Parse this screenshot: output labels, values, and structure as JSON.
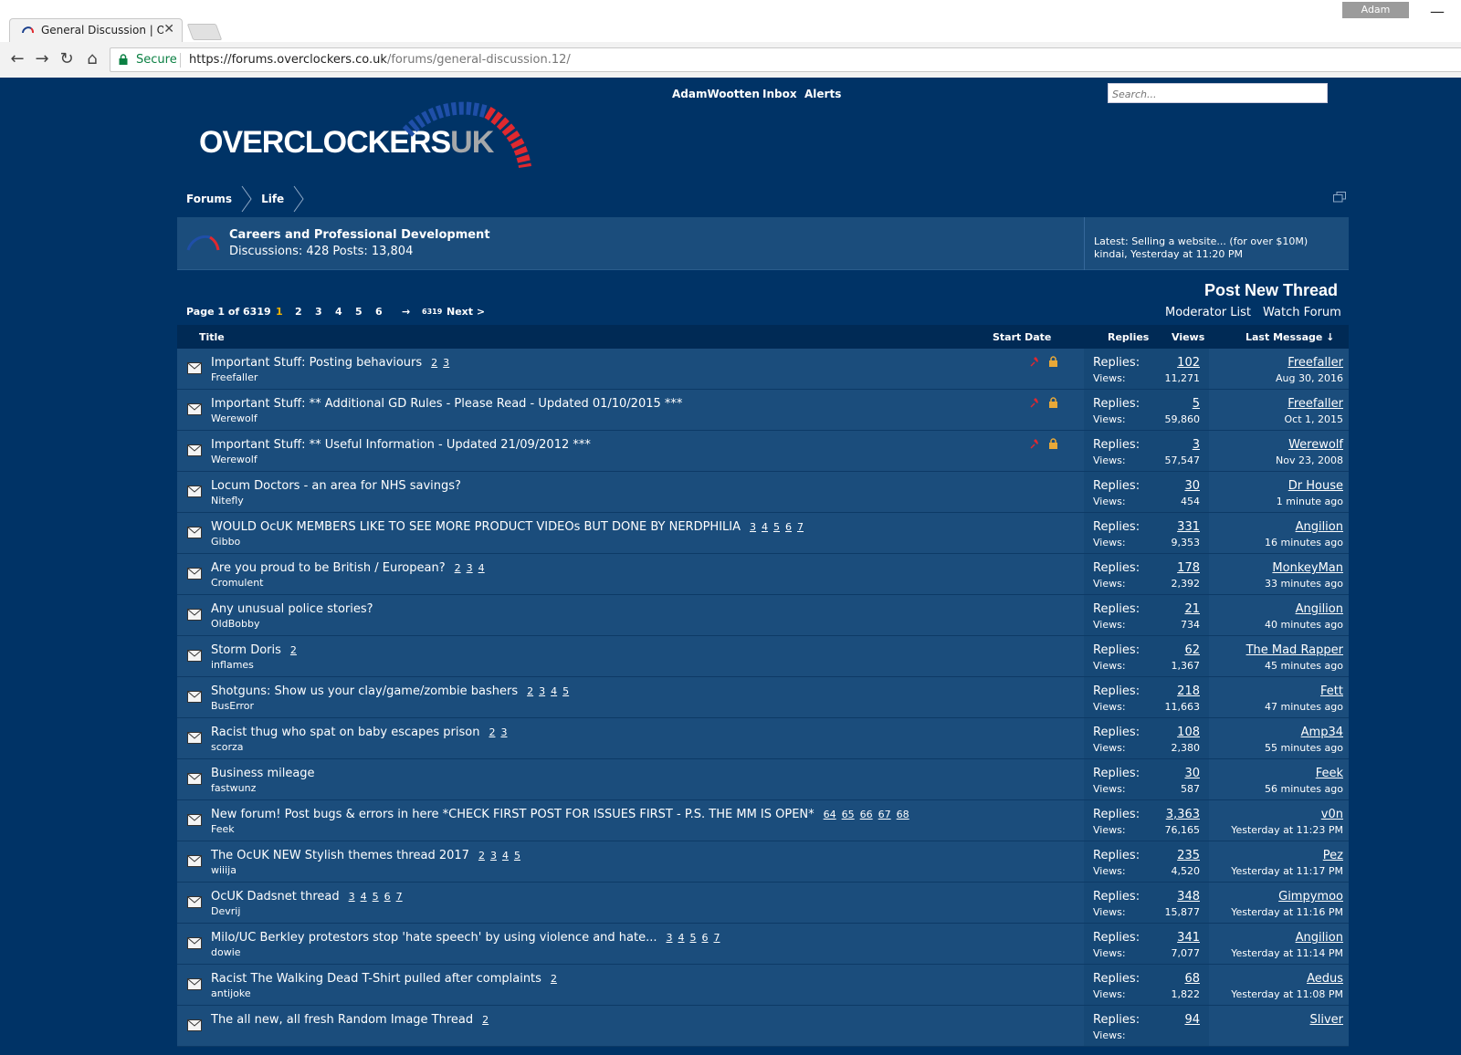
{
  "browser": {
    "tab_title": "General Discussion | Ove",
    "profile_name": "Adam",
    "secure_label": "Secure",
    "url_prefix": "https://forums.overclockers.co.uk",
    "url_path": "/forums/general-discussion.12/"
  },
  "header": {
    "nav": {
      "user": "AdamWootten",
      "inbox": "Inbox",
      "alerts": "Alerts"
    },
    "search_placeholder": "Search...",
    "logo_main": "OVERCLOCKERS",
    "logo_uk": "UK"
  },
  "breadcrumb": [
    "Forums",
    "Life"
  ],
  "forum_box": {
    "name": "Careers and Professional Development",
    "stats": "Discussions: 428 Posts: 13,804",
    "latest_line1": "Latest: Selling a website... (for over $10M)",
    "latest_line2": "kindai, Yesterday at 11:20 PM"
  },
  "actions": {
    "post_new_thread": "Post New Thread",
    "moderator_list": "Moderator List",
    "watch_forum": "Watch Forum"
  },
  "pagination": {
    "page_of": "Page 1 of 6319",
    "current": "1",
    "pages": [
      "2",
      "3",
      "4",
      "5",
      "6"
    ],
    "arrow": "→",
    "last": "6319",
    "next": "Next >"
  },
  "columns": {
    "title": "Title",
    "start_date": "Start Date",
    "replies": "Replies",
    "views": "Views",
    "last_message": "Last Message ↓"
  },
  "stat_labels": {
    "replies": "Replies:",
    "views": "Views:"
  },
  "threads": [
    {
      "prefix": "Important Stuff:",
      "title": "Posting behaviours",
      "pages": "2 3",
      "author": "Freefaller",
      "replies": "102",
      "views": "11,271",
      "last_user": "Freefaller",
      "last_time": "Aug 30, 2016",
      "sticky": true
    },
    {
      "prefix": "Important Stuff:",
      "title": "** Additional GD Rules - Please Read - Updated 01/10/2015 ***",
      "pages": "",
      "author": "Werewolf",
      "replies": "5",
      "views": "59,860",
      "last_user": "Freefaller",
      "last_time": "Oct 1, 2015",
      "sticky": true
    },
    {
      "prefix": "Important Stuff:",
      "title": "** Useful Information - Updated 21/09/2012 ***",
      "pages": "",
      "author": "Werewolf",
      "replies": "3",
      "views": "57,547",
      "last_user": "Werewolf",
      "last_time": "Nov 23, 2008",
      "sticky": true
    },
    {
      "prefix": "",
      "title": "Locum Doctors - an area for NHS savings?",
      "pages": "",
      "author": "Nitefly",
      "replies": "30",
      "views": "454",
      "last_user": "Dr House",
      "last_time": "1 minute ago",
      "sticky": false
    },
    {
      "prefix": "",
      "title": "WOULD OcUK MEMBERS LIKE TO SEE MORE PRODUCT VIDEOs BUT DONE BY NERDPHILIA",
      "pages": "3 4 5 6 7",
      "author": "Gibbo",
      "replies": "331",
      "views": "9,353",
      "last_user": "Angilion",
      "last_time": "16 minutes ago",
      "sticky": false
    },
    {
      "prefix": "",
      "title": "Are you proud to be British / European?",
      "pages": "2 3 4",
      "author": "Cromulent",
      "replies": "178",
      "views": "2,392",
      "last_user": "MonkeyMan",
      "last_time": "33 minutes ago",
      "sticky": false
    },
    {
      "prefix": "",
      "title": "Any unusual police stories?",
      "pages": "",
      "author": "OldBobby",
      "replies": "21",
      "views": "734",
      "last_user": "Angilion",
      "last_time": "40 minutes ago",
      "sticky": false
    },
    {
      "prefix": "",
      "title": "Storm Doris",
      "pages": "2",
      "author": "inflames",
      "replies": "62",
      "views": "1,367",
      "last_user": "The Mad Rapper",
      "last_time": "45 minutes ago",
      "sticky": false
    },
    {
      "prefix": "",
      "title": "Shotguns: Show us your clay/game/zombie bashers",
      "pages": "2 3 4 5",
      "author": "BusError",
      "replies": "218",
      "views": "11,663",
      "last_user": "Fett",
      "last_time": "47 minutes ago",
      "sticky": false
    },
    {
      "prefix": "",
      "title": "Racist thug who spat on baby escapes prison",
      "pages": "2 3",
      "author": "scorza",
      "replies": "108",
      "views": "2,380",
      "last_user": "Amp34",
      "last_time": "55 minutes ago",
      "sticky": false
    },
    {
      "prefix": "",
      "title": "Business mileage",
      "pages": "",
      "author": "fastwunz",
      "replies": "30",
      "views": "587",
      "last_user": "Feek",
      "last_time": "56 minutes ago",
      "sticky": false
    },
    {
      "prefix": "",
      "title": "New forum! Post bugs & errors in here *CHECK FIRST POST FOR ISSUES FIRST - P.S. THE MM IS OPEN*",
      "pages": "64 65 66 67 68",
      "author": "Feek",
      "replies": "3,363",
      "views": "76,165",
      "last_user": "v0n",
      "last_time": "Yesterday at 11:23 PM",
      "sticky": false
    },
    {
      "prefix": "",
      "title": "The OcUK NEW Stylish themes thread 2017",
      "pages": "2 3 4 5",
      "author": "wiiija",
      "replies": "235",
      "views": "4,520",
      "last_user": "Pez",
      "last_time": "Yesterday at 11:17 PM",
      "sticky": false
    },
    {
      "prefix": "",
      "title": "OcUK Dadsnet thread",
      "pages": "3 4 5 6 7",
      "author": "Devrij",
      "replies": "348",
      "views": "15,877",
      "last_user": "Gimpymoo",
      "last_time": "Yesterday at 11:16 PM",
      "sticky": false
    },
    {
      "prefix": "",
      "title": "Milo/UC Berkley protestors stop 'hate speech' by using violence and hate...",
      "pages": "3 4 5 6 7",
      "author": "dowie",
      "replies": "341",
      "views": "7,077",
      "last_user": "Angilion",
      "last_time": "Yesterday at 11:14 PM",
      "sticky": false
    },
    {
      "prefix": "",
      "title": "Racist The Walking Dead T-Shirt pulled after complaints",
      "pages": "2",
      "author": "antijoke",
      "replies": "68",
      "views": "1,822",
      "last_user": "Aedus",
      "last_time": "Yesterday at 11:08 PM",
      "sticky": false
    },
    {
      "prefix": "",
      "title": "The all new, all fresh Random Image Thread",
      "pages": "2",
      "author": "",
      "replies": "94",
      "views": "",
      "last_user": "Sliver",
      "last_time": "",
      "sticky": false
    }
  ],
  "colors": {
    "page_bg": "#003366",
    "row_bg": "#1b4d7c",
    "accent_red": "#e0292f",
    "current_page": "#f0b400"
  }
}
